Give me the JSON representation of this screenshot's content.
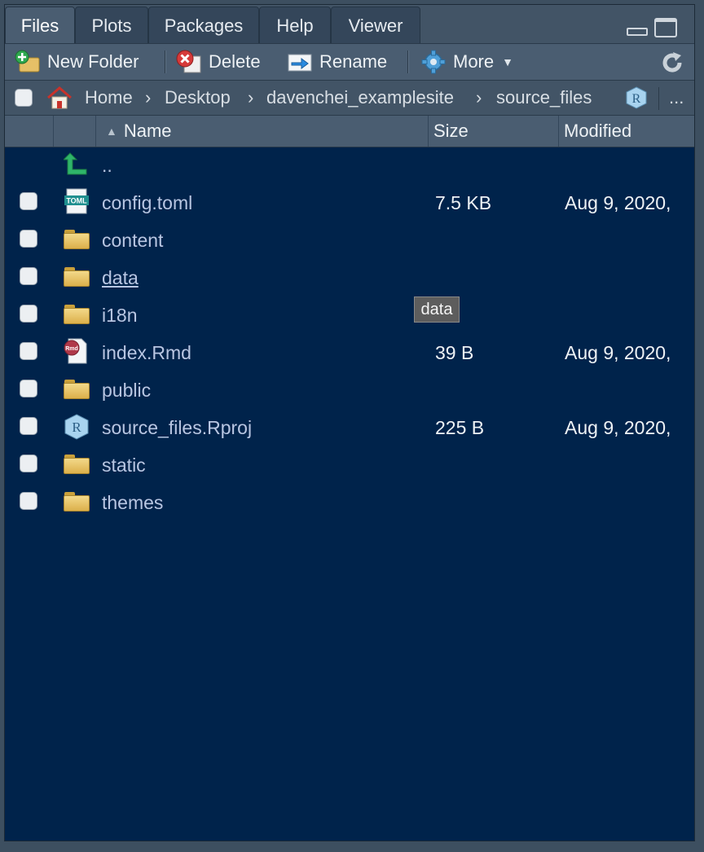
{
  "tabs": [
    {
      "label": "Files",
      "active": true
    },
    {
      "label": "Plots"
    },
    {
      "label": "Packages"
    },
    {
      "label": "Help"
    },
    {
      "label": "Viewer"
    }
  ],
  "toolbar": {
    "new_folder": "New Folder",
    "delete": "Delete",
    "rename": "Rename",
    "more": "More"
  },
  "breadcrumb": {
    "items": [
      "Home",
      "Desktop",
      "davenchei_examplesite",
      "source_files"
    ],
    "overflow": "..."
  },
  "columns": {
    "name": "Name",
    "size": "Size",
    "modified": "Modified"
  },
  "parent_label": "..",
  "files": [
    {
      "name": "config.toml",
      "size": "7.5 KB",
      "modified": "Aug 9, 2020,",
      "icon": "toml-file-icon"
    },
    {
      "name": "content",
      "size": "",
      "modified": "",
      "icon": "folder-icon"
    },
    {
      "name": "data",
      "size": "",
      "modified": "",
      "icon": "folder-icon"
    },
    {
      "name": "i18n",
      "size": "",
      "modified": "",
      "icon": "folder-icon"
    },
    {
      "name": "index.Rmd",
      "size": "39 B",
      "modified": "Aug 9, 2020,",
      "icon": "rmd-file-icon"
    },
    {
      "name": "public",
      "size": "",
      "modified": "",
      "icon": "folder-icon"
    },
    {
      "name": "source_files.Rproj",
      "size": "225 B",
      "modified": "Aug 9, 2020,",
      "icon": "rproj-file-icon"
    },
    {
      "name": "static",
      "size": "",
      "modified": "",
      "icon": "folder-icon"
    },
    {
      "name": "themes",
      "size": "",
      "modified": "",
      "icon": "folder-icon"
    }
  ],
  "tooltip": "data",
  "colors": {
    "list_background": "#00234b",
    "file_name": "#b9c6e2",
    "toolbar": "#4a5d71"
  }
}
